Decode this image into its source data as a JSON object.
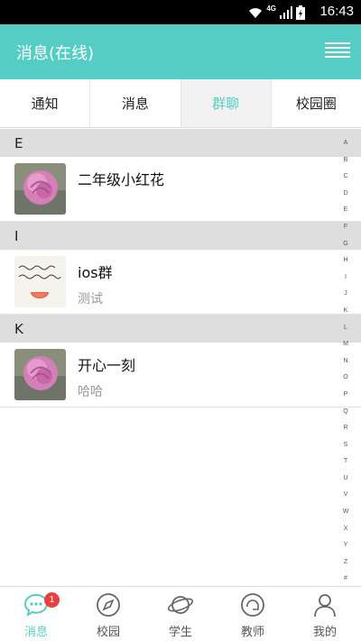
{
  "status_bar": {
    "time": "16:43",
    "network": "4G"
  },
  "header": {
    "title": "消息(在线)"
  },
  "tabs": [
    {
      "label": "通知",
      "active": false
    },
    {
      "label": "消息",
      "active": false
    },
    {
      "label": "群聊",
      "active": true
    },
    {
      "label": "校园圈",
      "active": false
    }
  ],
  "sections": [
    {
      "letter": "E",
      "items": [
        {
          "name": "二年级小红花",
          "last_message": ""
        }
      ]
    },
    {
      "letter": "I",
      "items": [
        {
          "name": "ios群",
          "last_message": "测试"
        }
      ]
    },
    {
      "letter": "K",
      "items": [
        {
          "name": "开心一刻",
          "last_message": "哈哈"
        }
      ]
    }
  ],
  "index_letters": [
    "A",
    "B",
    "C",
    "D",
    "E",
    "F",
    "G",
    "H",
    "I",
    "J",
    "K",
    "L",
    "M",
    "N",
    "O",
    "P",
    "Q",
    "R",
    "S",
    "T",
    "U",
    "V",
    "W",
    "X",
    "Y",
    "Z",
    "#"
  ],
  "bottom_nav": [
    {
      "label": "消息",
      "icon": "chat-bubble-icon",
      "active": true,
      "badge": "1"
    },
    {
      "label": "校园",
      "icon": "compass-icon",
      "active": false
    },
    {
      "label": "学生",
      "icon": "planet-icon",
      "active": false
    },
    {
      "label": "教师",
      "icon": "chat-circle-icon",
      "active": false
    },
    {
      "label": "我的",
      "icon": "user-icon",
      "active": false
    }
  ],
  "colors": {
    "accent": "#55cdc4",
    "badge": "#e8413d",
    "section_bg": "#dedede"
  }
}
